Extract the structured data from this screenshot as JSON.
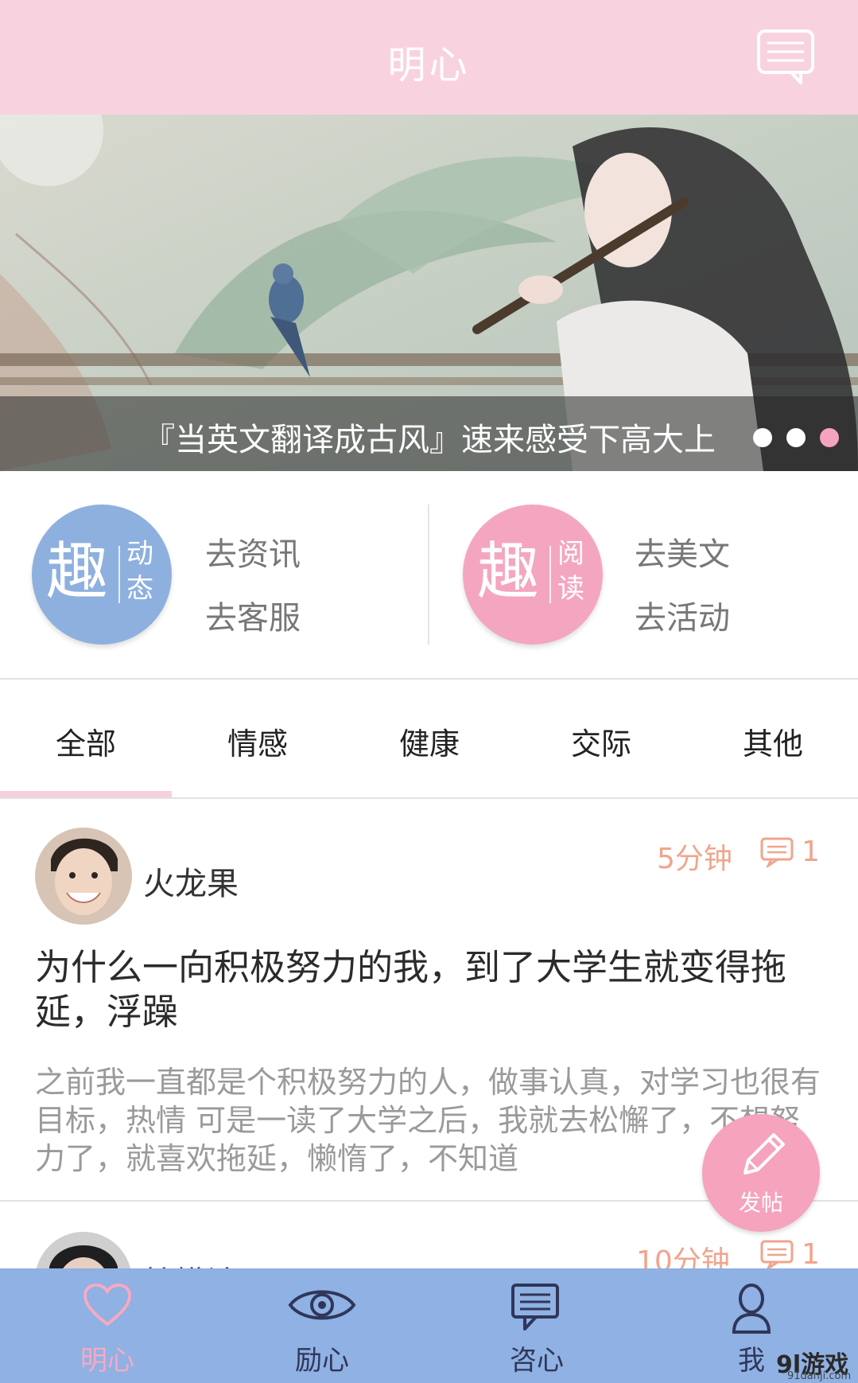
{
  "header": {
    "title": "明心",
    "message_icon": "message-list-icon"
  },
  "banner": {
    "caption": "『当英文翻译成古风』速来感受下高大上",
    "slide_count": 3,
    "active_slide": 3
  },
  "quick_entries": {
    "left": {
      "big_char": "趣",
      "small_chars": "动态",
      "color": "#8eb0df",
      "links": [
        "去资讯",
        "去客服"
      ]
    },
    "right": {
      "big_char": "趣",
      "small_chars": "阅读",
      "color": "#f4a6c1",
      "links": [
        "去美文",
        "去活动"
      ]
    }
  },
  "tabs": [
    "全部",
    "情感",
    "健康",
    "交际",
    "其他"
  ],
  "active_tab": "全部",
  "posts": [
    {
      "author": "火龙果",
      "time": "5分钟",
      "comments": "1",
      "title": "为什么一向积极努力的我，到了大学生就变得拖延，浮躁",
      "excerpt": "之前我一直都是个积极努力的人，做事认真，对学习也很有目标，热情 可是一读了大学之后，我就去松懈了，不想努力了，就喜欢拖延，懒惰了，不知道"
    },
    {
      "author": "柠檬汁",
      "time": "10分钟",
      "comments": "1"
    }
  ],
  "fab": {
    "label": "发帖",
    "icon": "pencil-icon"
  },
  "bottom_nav": [
    {
      "label": "明心",
      "icon": "heart-icon",
      "active": true
    },
    {
      "label": "励心",
      "icon": "eye-icon",
      "active": false
    },
    {
      "label": "咨心",
      "icon": "chat-icon",
      "active": false
    },
    {
      "label": "我",
      "icon": "person-icon",
      "active": false
    }
  ],
  "watermark": {
    "text": "9l游戏",
    "url": "91danji.com"
  },
  "colors": {
    "header": "#f8d3df",
    "nav": "#8fb1e3",
    "accent_pink": "#f6a3bd",
    "meta_orange": "#f0a58d"
  }
}
